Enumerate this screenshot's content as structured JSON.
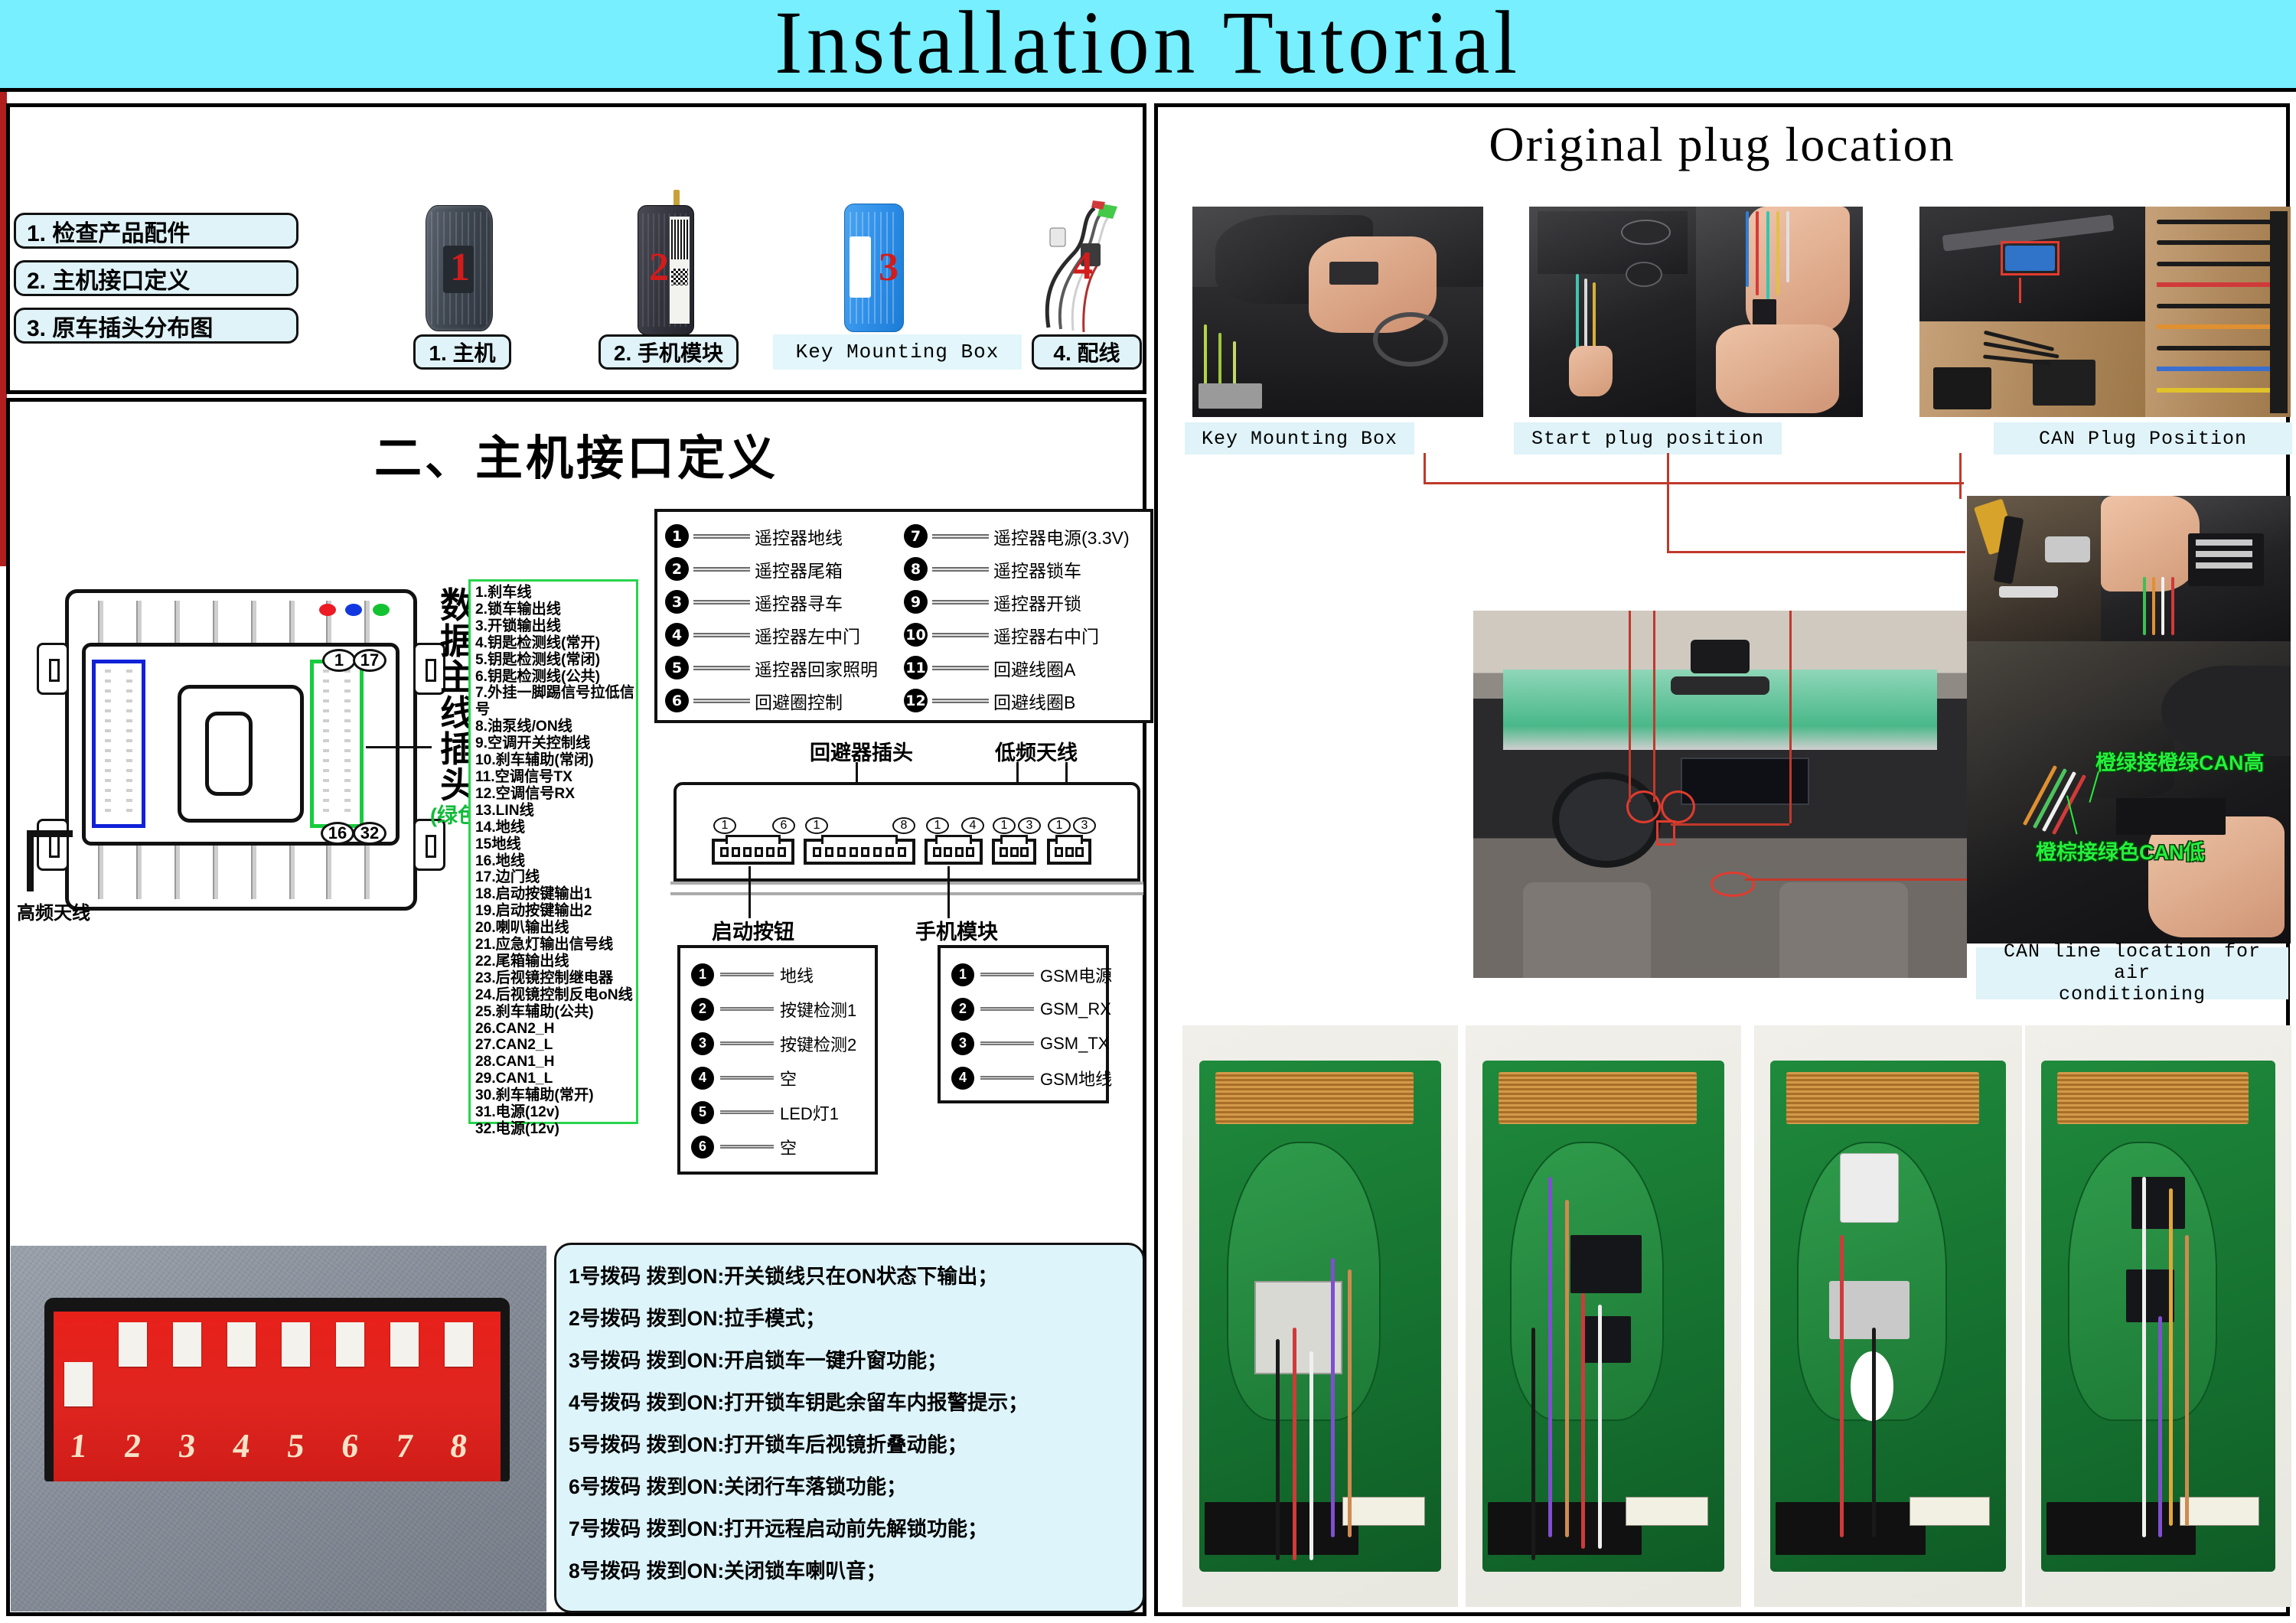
{
  "title": "Installation Tutorial",
  "checklist": [
    {
      "label": "1. 检查产品配件"
    },
    {
      "label": "2. 主机接口定义"
    },
    {
      "label": "3. 原车插头分布图"
    }
  ],
  "products": [
    {
      "num": "1",
      "caption": "1. 主机"
    },
    {
      "num": "2",
      "caption": "2. 手机模块"
    },
    {
      "num": "3",
      "caption": "Key Mounting Box"
    },
    {
      "num": "4",
      "caption": "4. 配线"
    }
  ],
  "section2": {
    "title": "二、主机接口定义",
    "vertical_label": "数据主线插头",
    "vertical_label_note": "(绿色)",
    "antenna_label": "高频天线",
    "pins": {
      "top_left": "1",
      "top_right": "17",
      "bottom_left": "16",
      "bottom_right": "32"
    },
    "wire_list": [
      "1.刹车线",
      "2.锁车输出线",
      "3.开锁输出线",
      "4.钥匙检测线(常开)",
      "5.钥匙检测线(常闭)",
      "6.钥匙检测线(公共)",
      "7.外挂一脚踢信号拉低信号",
      "8.油泵线/ON线",
      "9.空调开关控制线",
      "10.刹车辅助(常闭)",
      "11.空调信号TX",
      "12.空调信号RX",
      "13.LIN线",
      "14.地线",
      "15地线",
      "16.地线",
      "17.边门线",
      "18.启动按键输出1",
      "19.启动按键输出2",
      "20.喇叭输出线",
      "21.应急灯输出信号线",
      "22.尾箱输出线",
      "23.后视镜控制继电器",
      "24.后视镜控制反电oN线",
      "25.刹车辅助(公共)",
      "26.CAN2_H",
      "27.CAN2_L",
      "28.CAN1_H",
      "29.CAN1_L",
      "30.刹车辅助(常开)",
      "31.电源(12v)",
      "32.电源(12v)"
    ]
  },
  "remote_functions": {
    "left": [
      {
        "num": "1",
        "label": "遥控器地线"
      },
      {
        "num": "2",
        "label": "遥控器尾箱"
      },
      {
        "num": "3",
        "label": "遥控器寻车"
      },
      {
        "num": "4",
        "label": "遥控器左中门"
      },
      {
        "num": "5",
        "label": "遥控器回家照明"
      },
      {
        "num": "6",
        "label": "回避圈控制"
      }
    ],
    "right": [
      {
        "num": "7",
        "label": "遥控器电源(3.3V)"
      },
      {
        "num": "8",
        "label": "遥控器锁车"
      },
      {
        "num": "9",
        "label": "遥控器开锁"
      },
      {
        "num": "10",
        "label": "遥控器右中门"
      },
      {
        "num": "11",
        "label": "回避线圈A"
      },
      {
        "num": "12",
        "label": "回避线圈B"
      }
    ]
  },
  "connector_strip": {
    "labels": {
      "avoid_plug": "回避器插头",
      "low_freq_antenna": "低频天线",
      "start_button": "启动按钮",
      "phone_module": "手机模块"
    },
    "connectors": [
      {
        "name": "start-button-connector",
        "first": "1",
        "last": "6",
        "pins": 6
      },
      {
        "name": "avoid-plug-connector",
        "first": "1",
        "last": "8",
        "pins": 8
      },
      {
        "name": "phone-module-connector",
        "first": "1",
        "last": "4",
        "pins": 4
      },
      {
        "name": "antenna-connector-1",
        "first": "1",
        "last": "3",
        "pins": 3
      },
      {
        "name": "antenna-connector-2",
        "first": "1",
        "last": "3",
        "pins": 3
      }
    ]
  },
  "start_button_pinout": [
    {
      "num": "1",
      "label": "地线"
    },
    {
      "num": "2",
      "label": "按键检测1"
    },
    {
      "num": "3",
      "label": "按键检测2"
    },
    {
      "num": "4",
      "label": "空"
    },
    {
      "num": "5",
      "label": "LED灯1"
    },
    {
      "num": "6",
      "label": "空"
    }
  ],
  "phone_module_pinout": [
    {
      "num": "1",
      "label": "GSM电源"
    },
    {
      "num": "2",
      "label": "GSM_RX"
    },
    {
      "num": "3",
      "label": "GSM_TX"
    },
    {
      "num": "4",
      "label": "GSM地线"
    }
  ],
  "dip_switch": {
    "numbers": [
      "1",
      "2",
      "3",
      "4",
      "5",
      "6",
      "7",
      "8"
    ],
    "states": [
      "down",
      "up",
      "up",
      "up",
      "up",
      "up",
      "up",
      "up"
    ],
    "instructions": [
      "1号拨码 拨到ON:开关锁线只在ON状态下输出；",
      "2号拨码 拨到ON:拉手模式；",
      "3号拨码 拨到ON:开启锁车一键升窗功能；",
      "4号拨码 拨到ON:打开锁车钥匙余留车内报警提示；",
      "5号拨码 拨到ON:打开锁车后视镜折叠动能；",
      "6号拨码 拨到ON:关闭行车落锁功能；",
      "7号拨码 拨到ON:打开远程启动前先解锁功能；",
      "8号拨码 拨到ON:关闭锁车喇叭音；"
    ]
  },
  "right_panel": {
    "title": "Original plug location",
    "captions": {
      "key_mounting_box": "Key Mounting Box",
      "start_plug_position": "Start plug position",
      "can_plug_position": "CAN Plug Position",
      "can_line_ac_1": "CAN line location for air",
      "can_line_ac_2": "conditioning"
    },
    "can_annotations": {
      "high": "橙绿接橙绿CAN高",
      "low": "橙棕接绿色CAN低"
    }
  },
  "colors": {
    "title_bar": "#77efff",
    "pill_fill": "#dff3f8",
    "green_connector": "#17cc3e",
    "blue_connector": "#1021d8",
    "red_annotation": "#c0392b",
    "dip_red": "#e0251f",
    "green_text": "#25f03c"
  }
}
